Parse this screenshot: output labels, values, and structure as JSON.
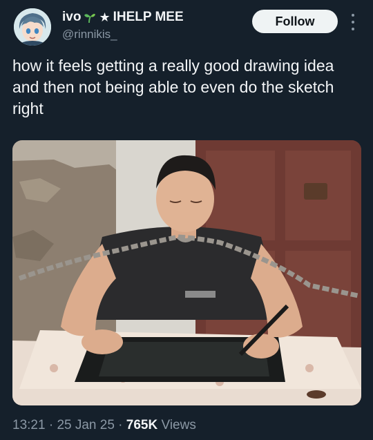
{
  "user": {
    "display_name": "ivo",
    "name_suffix": "IHELP MEE",
    "handle": "@rinnikis_",
    "avatar_icon": "anime-avatar-icon",
    "badges": [
      "sprout-emoji-icon",
      "star-icon"
    ]
  },
  "follow_label": "Follow",
  "tweet_text": "how it feels getting a really good drawing idea and then not being able to even do the sketch right",
  "media": {
    "kind": "photo"
  },
  "meta": {
    "time": "13:21",
    "sep1": " · ",
    "date": "25 Jan 25",
    "sep2": " · ",
    "views_count": "765K",
    "views_label": " Views"
  },
  "colors": {
    "background": "#15202b",
    "text": "#f3f5f7",
    "muted": "#8b98a5",
    "button_bg": "#eff3f4"
  }
}
